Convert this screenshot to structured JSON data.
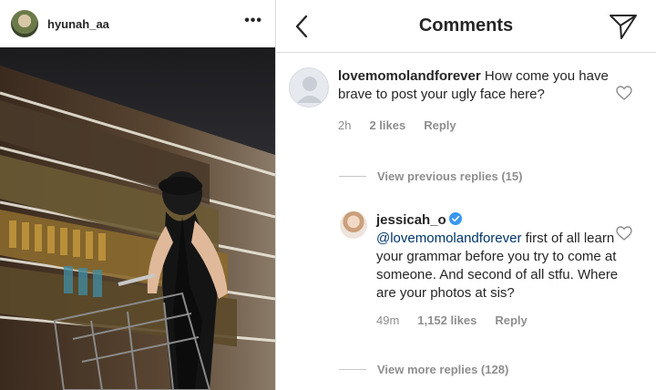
{
  "post": {
    "username": "hyunah_aa",
    "more_icon": "more-horizontal-icon"
  },
  "comments_view": {
    "title": "Comments",
    "back_icon": "chevron-left-icon",
    "send_icon": "send-icon",
    "comment": {
      "username": "lovemomolandforever",
      "text": "How come you have brave to post your ugly face here?",
      "time": "2h",
      "likes": "2 likes",
      "reply": "Reply"
    },
    "view_previous": "View previous replies (15)",
    "reply": {
      "username": "jessicah_o",
      "mention": "@lovemomolandforever",
      "text": "first of all learn your grammar before you try to come at someone. And second of all stfu. Where are your photos at sis?",
      "time": "49m",
      "likes": "1,152 likes",
      "reply": "Reply"
    },
    "view_more": "View more replies (128)"
  },
  "colors": {
    "text": "#262626",
    "muted": "#8e8e8e",
    "mention": "#003569",
    "verified": "#3897f0",
    "border": "#dbdbdb"
  }
}
